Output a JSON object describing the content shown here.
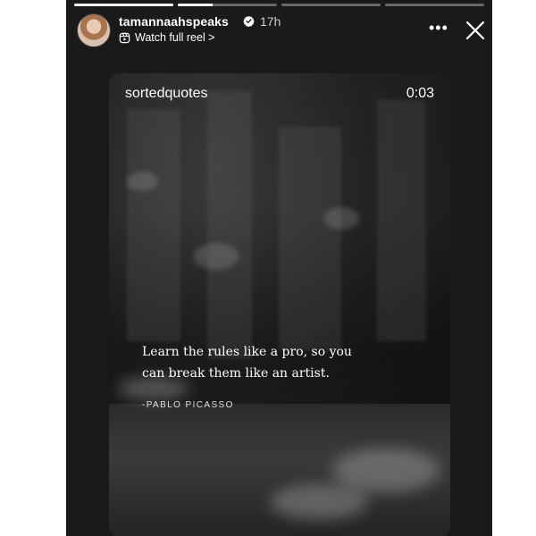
{
  "story": {
    "progress": [
      {
        "fraction": 1.0
      },
      {
        "fraction": 0.35
      },
      {
        "fraction": 0.0
      },
      {
        "fraction": 0.0
      }
    ],
    "header": {
      "username": "tamannaahspeaks",
      "time": "17h",
      "link_label": "Watch full reel >",
      "more_label": "•••"
    },
    "card": {
      "source": "sortedquotes",
      "duration": "0:03",
      "quote_line1": "Learn the rules like a pro, so you",
      "quote_line2": "can break them like an artist.",
      "author": "-PABLO PICASSO"
    },
    "colors": {
      "background": "#1a1a1a",
      "text": "#ffffff",
      "verified_badge": "#ffffff"
    },
    "icons": [
      "verified-badge-icon",
      "reel-icon",
      "more-icon",
      "close-icon"
    ]
  }
}
